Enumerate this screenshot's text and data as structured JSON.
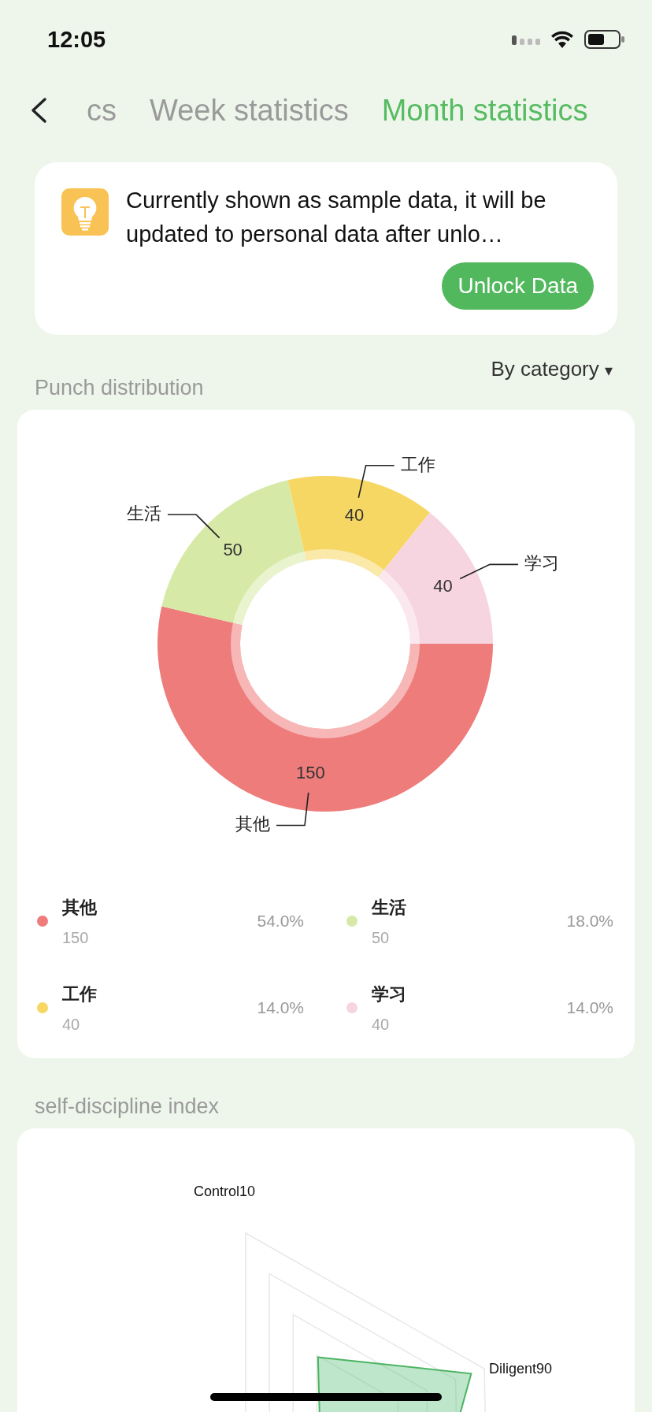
{
  "status_bar": {
    "time": "12:05"
  },
  "tabs": [
    {
      "label": "cs",
      "selected": false
    },
    {
      "label": "Week statistics",
      "selected": false
    },
    {
      "label": "Month statistics",
      "selected": true
    }
  ],
  "notice": {
    "text": "Currently shown as sample data, it will be updated to personal data after unlo…",
    "button": "Unlock Data"
  },
  "distribution": {
    "title": "Punch distribution",
    "filter": "By category",
    "filter_caret": "▾",
    "chart_data": {
      "type": "donut",
      "categories": [
        "其他",
        "生活",
        "工作",
        "学习"
      ],
      "values": [
        150,
        50,
        40,
        40
      ],
      "colors": [
        "#ee7c7b",
        "#d7e9a6",
        "#f7d764",
        "#f6d5e1"
      ],
      "data_labels": true
    },
    "legend": [
      {
        "name": "其他",
        "count": "150",
        "percent": "54.0%",
        "color": "#ee7c7b"
      },
      {
        "name": "生活",
        "count": "50",
        "percent": "18.0%",
        "color": "#d7e9a6"
      },
      {
        "name": "工作",
        "count": "40",
        "percent": "14.0%",
        "color": "#f7d764"
      },
      {
        "name": "学习",
        "count": "40",
        "percent": "14.0%",
        "color": "#f6d5e1"
      }
    ]
  },
  "discipline": {
    "title": "self-discipline index",
    "labels": [
      "Control10",
      "Diligent90"
    ]
  }
}
